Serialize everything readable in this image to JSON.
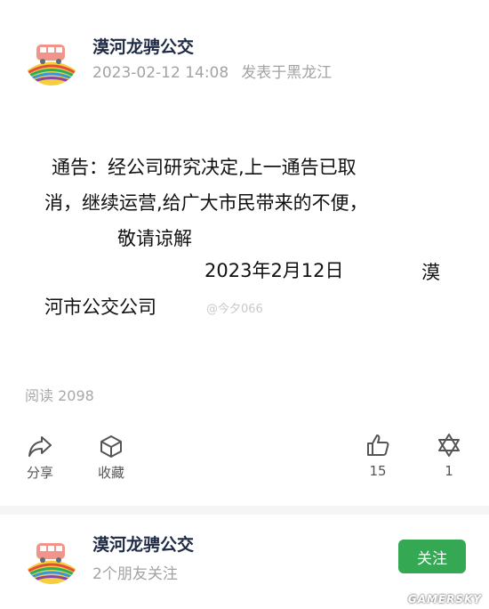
{
  "post": {
    "author": "漠河龙骋公交",
    "timestamp": "2023-02-12 14:08",
    "location": "发表于黑龙江",
    "lines": [
      "通告：经公司研究决定,上一通告已取",
      "消，继续运营,给广大市民带来的不便，",
      "敬请谅解",
      "2023年2月12日",
      "漠",
      "河市公交公司"
    ],
    "watermark": "@今夕066",
    "reads": "阅读 2098"
  },
  "actions": {
    "share": "分享",
    "favorite": "收藏",
    "like_count": "15",
    "other_count": "1"
  },
  "profile": {
    "name": "漠河龙骋公交",
    "followers": "2个朋友关注",
    "follow_label": "关注"
  },
  "source_mark": "GAMERSKY",
  "colors": {
    "follow_button": "#34a853",
    "meta_text": "#a3a3a3",
    "name_text": "#1f2a44"
  }
}
